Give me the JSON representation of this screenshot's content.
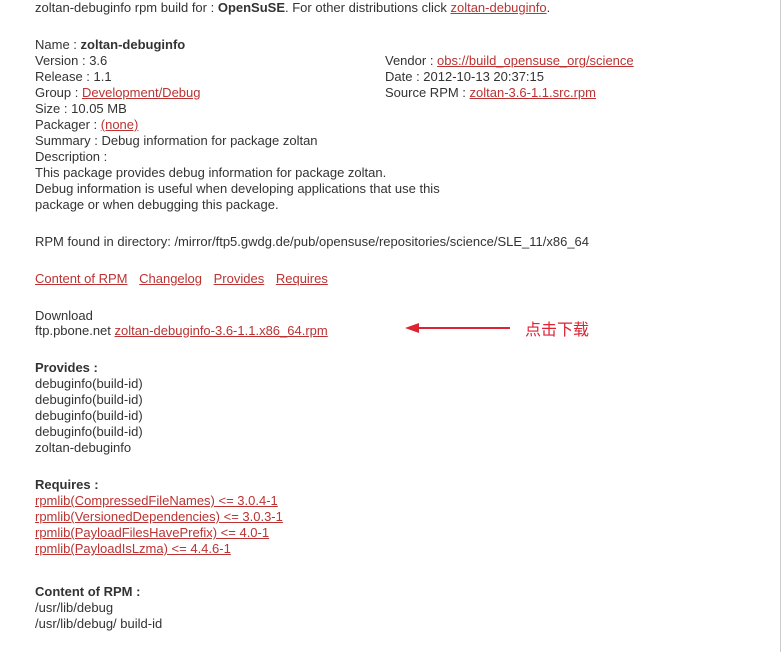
{
  "intro": {
    "prefix": "zoltan-debuginfo rpm build for : ",
    "distro": "OpenSuSE",
    "middle": ". For other distributions click ",
    "link": "zoltan-debuginfo",
    "suffix": "."
  },
  "fields": {
    "name_label": "Name : ",
    "name_value": "zoltan-debuginfo",
    "version_label": "Version : 3.6",
    "vendor_label": "Vendor : ",
    "vendor_link": "obs://build_opensuse_org/science",
    "release_label": "Release : 1.1",
    "date_label": "Date : 2012-10-13 20:37:15",
    "group_label": "Group : ",
    "group_link": "Development/Debug",
    "source_label": "Source RPM : ",
    "source_link": "zoltan-3.6-1.1.src.rpm",
    "size_label": "Size : 10.05 MB",
    "packager_label": "Packager : ",
    "packager_link": "(none)",
    "summary_label": "Summary : Debug information for package zoltan",
    "description_label": "Description :",
    "desc_line1": "This package provides debug information for package zoltan.",
    "desc_line2": "Debug information is useful when developing applications that use this",
    "desc_line3": "package or when debugging this package."
  },
  "rpm_found": "RPM found in directory: /mirror/ftp5.gwdg.de/pub/opensuse/repositories/science/SLE_11/x86_64",
  "links": {
    "content": "Content of RPM",
    "changelog": "Changelog",
    "provides": "Provides",
    "requires": "Requires"
  },
  "download": {
    "label": "Download",
    "server": "ftp.pbone.net",
    "file": "zoltan-debuginfo-3.6-1.1.x86_64.rpm"
  },
  "annotation": "点击下载",
  "provides": {
    "header": "Provides :",
    "items": [
      "debuginfo(build-id)",
      "debuginfo(build-id)",
      "debuginfo(build-id)",
      "debuginfo(build-id)",
      "zoltan-debuginfo"
    ]
  },
  "requires": {
    "header": "Requires :",
    "items": [
      "rpmlib(CompressedFileNames) <= 3.0.4-1",
      "rpmlib(VersionedDependencies) <= 3.0.3-1",
      "rpmlib(PayloadFilesHavePrefix) <= 4.0-1",
      "rpmlib(PayloadIsLzma) <= 4.4.6-1"
    ]
  },
  "content_rpm": {
    "header": "Content of RPM :",
    "items": [
      "/usr/lib/debug",
      "/usr/lib/debug/ build-id"
    ]
  }
}
